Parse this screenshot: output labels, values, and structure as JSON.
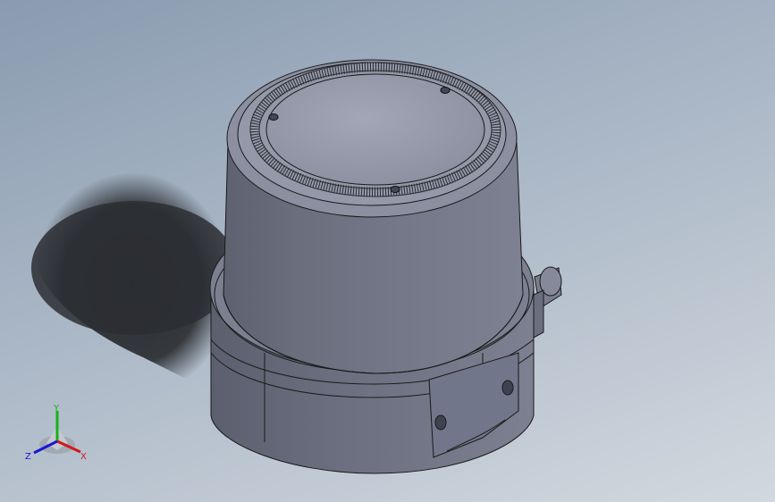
{
  "viewport": {
    "background_top": "#8a9bb0",
    "background_bottom": "#d2d8df"
  },
  "model": {
    "body_color": "#6f7383",
    "edge_color": "#1a1a1a",
    "top_face_color": "#9a9eae"
  },
  "triad": {
    "x_label": "X",
    "y_label": "Y",
    "z_label": "Z",
    "x_color": "#d01818",
    "y_color": "#18b018",
    "z_color": "#1818d0"
  }
}
